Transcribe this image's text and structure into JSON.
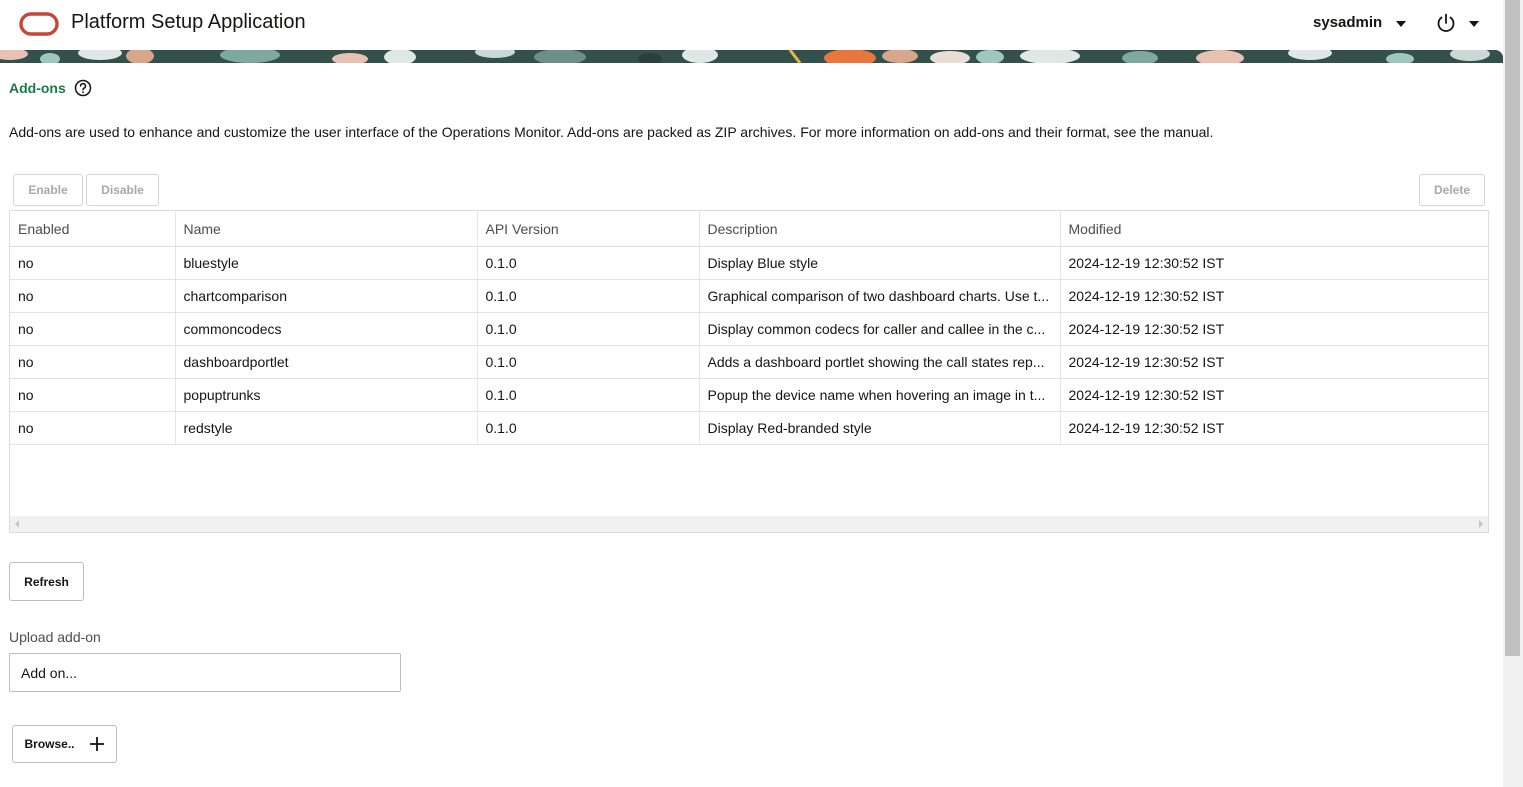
{
  "header": {
    "logo_icon": "oracle-logo-icon",
    "brand_color": "#c74634",
    "title": "Platform Setup Application",
    "user": "sysadmin",
    "power_icon": "power-icon"
  },
  "page": {
    "section_title": "Add-ons",
    "section_title_color": "#1c7a4a",
    "help_icon": "help-circle-icon",
    "intro": "Add-ons are used to enhance and customize the user interface of the Operations Monitor. Add-ons are packed as ZIP archives. For more information on add-ons and their format, see the manual."
  },
  "toolbar": {
    "enable_label": "Enable",
    "disable_label": "Disable",
    "delete_label": "Delete"
  },
  "table": {
    "columns": [
      "Enabled",
      "Name",
      "API Version",
      "Description",
      "Modified"
    ],
    "rows": [
      [
        "no",
        "bluestyle",
        "0.1.0",
        "Display Blue style",
        "2024-12-19 12:30:52 IST"
      ],
      [
        "no",
        "chartcomparison",
        "0.1.0",
        "Graphical comparison of two dashboard charts. Use t...",
        "2024-12-19 12:30:52 IST"
      ],
      [
        "no",
        "commoncodecs",
        "0.1.0",
        "Display common codecs for caller and callee in the c...",
        "2024-12-19 12:30:52 IST"
      ],
      [
        "no",
        "dashboardportlet",
        "0.1.0",
        "Adds a dashboard portlet showing the call states rep...",
        "2024-12-19 12:30:52 IST"
      ],
      [
        "no",
        "popuptrunks",
        "0.1.0",
        "Popup the device name when hovering an image in t...",
        "2024-12-19 12:30:52 IST"
      ],
      [
        "no",
        "redstyle",
        "0.1.0",
        "Display Red-branded style",
        "2024-12-19 12:30:52 IST"
      ]
    ]
  },
  "actions": {
    "refresh_label": "Refresh"
  },
  "upload": {
    "label": "Upload add-on",
    "placeholder": "Add on...",
    "browse_label": "Browse..",
    "plus_icon": "plus-icon"
  }
}
